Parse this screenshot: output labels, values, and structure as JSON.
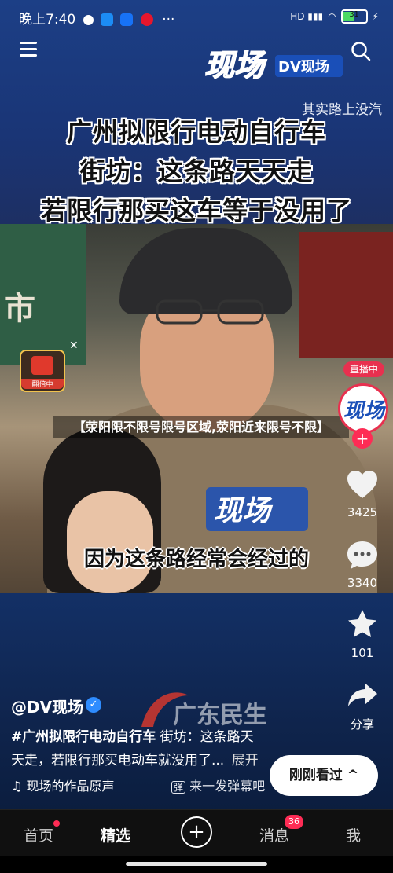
{
  "status_bar": {
    "time": "晚上7:40",
    "battery": "31"
  },
  "header": {
    "logo_text": "DV现场",
    "scroll_text": "其实路上没汽"
  },
  "title_lines": [
    "广州拟限行电动自行车",
    "街坊：这条路天天走",
    "若限行那买这车等于没用了"
  ],
  "video": {
    "subtitle": "因为这条路经常会经过的",
    "shop_sign": "市"
  },
  "red_packet": {
    "label": "翻倍中"
  },
  "overlay_title": "【荥阳限不限号限号区域,荥阳近来限号不限】",
  "rail": {
    "live_badge": "直播中",
    "likes": "3425",
    "comments": "3340",
    "favorites": "101",
    "share": "分享"
  },
  "info": {
    "author": "@DV现场",
    "hashtag": "#广州拟限行电动自行车",
    "desc_rest_1": " 街坊：这条路天",
    "desc_line2": "天走，若限行那买电动车就没用了...",
    "expand": "展开",
    "music": "现场的作品原声",
    "barrage": "来一发弹幕吧",
    "watermark": "广东民生"
  },
  "just_watched": "刚刚看过 ^",
  "nav": {
    "home": "首页",
    "select": "精选",
    "msg": "消息",
    "msg_badge": "36",
    "me": "我"
  },
  "colors": {
    "brand": "#fe2c55",
    "header_blue": "#1c3f86"
  },
  "icons": [
    "menu-icon",
    "search-icon",
    "heart-icon",
    "comment-icon",
    "star-icon",
    "share-icon",
    "music-icon",
    "barrage-icon",
    "plus-icon"
  ]
}
